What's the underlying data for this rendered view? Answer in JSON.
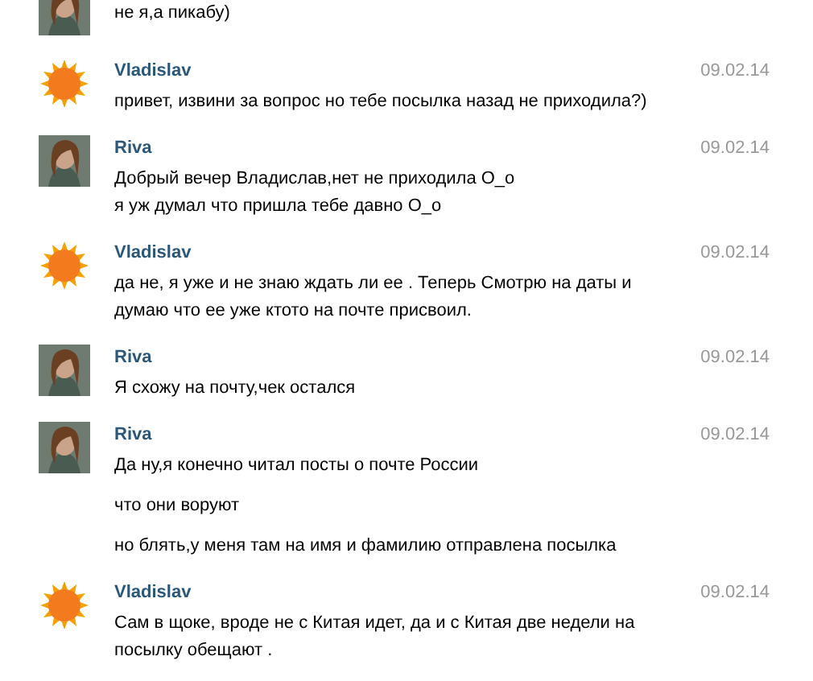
{
  "messages": [
    {
      "kind": "photo",
      "texts": [
        "не я,а пикабу)"
      ]
    },
    {
      "kind": "sun",
      "author": "Vladislav",
      "date": "09.02.14",
      "texts": [
        "привет, извини за вопрос но тебе посылка назад не приходила?)"
      ]
    },
    {
      "kind": "photo",
      "author": "Riva",
      "date": "09.02.14",
      "texts": [
        "Добрый вечер Владислав,нет не приходила О_о\nя уж думал что пришла тебе давно О_о"
      ]
    },
    {
      "kind": "sun",
      "author": "Vladislav",
      "date": "09.02.14",
      "texts": [
        "да не, я уже и не знаю ждать ли ее . Теперь Смотрю на даты и думаю что ее уже ктото на почте присвоил."
      ]
    },
    {
      "kind": "photo",
      "author": "Riva",
      "date": "09.02.14",
      "texts": [
        "Я схожу на почту,чек остался"
      ]
    },
    {
      "kind": "photo",
      "author": "Riva",
      "date": "09.02.14",
      "texts": [
        "Да ну,я конечно читал посты о почте России",
        "что они воруют",
        "но блять,у меня там на имя и фамилию отправлена посылка"
      ]
    },
    {
      "kind": "sun",
      "author": "Vladislav",
      "date": "09.02.14",
      "texts": [
        "Сам в щоке, вроде не с Китая идет, да и с Китая две недели на посылку обещают ."
      ]
    }
  ]
}
